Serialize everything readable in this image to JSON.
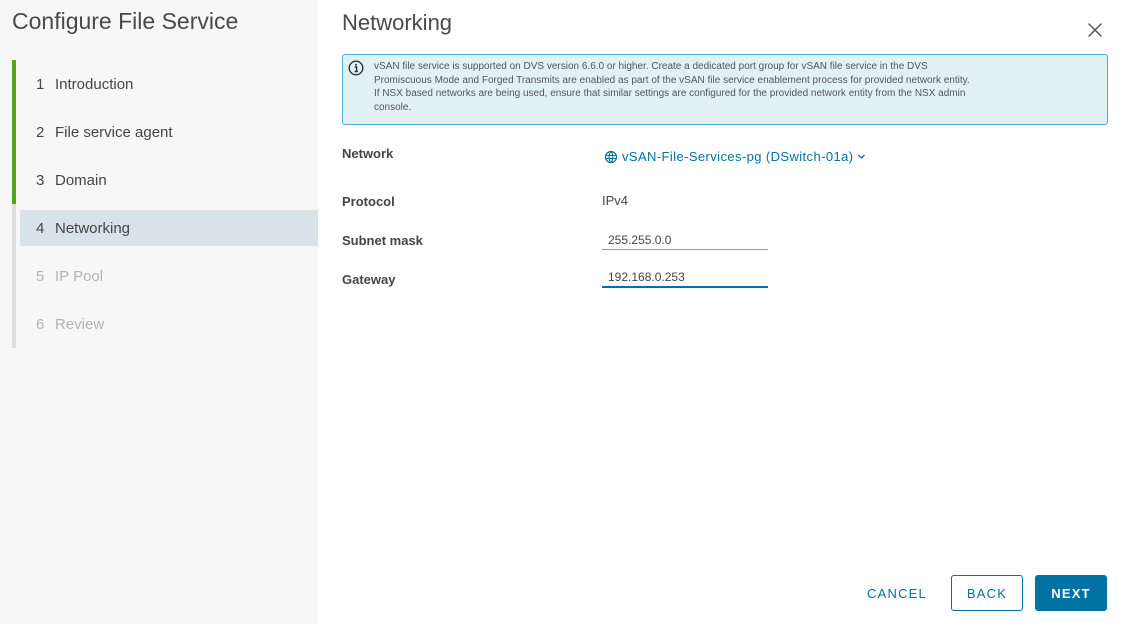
{
  "wizard": {
    "title": "Configure File Service",
    "steps": [
      {
        "num": "1",
        "label": "Introduction"
      },
      {
        "num": "2",
        "label": "File service agent"
      },
      {
        "num": "3",
        "label": "Domain"
      },
      {
        "num": "4",
        "label": "Networking"
      },
      {
        "num": "5",
        "label": "IP Pool"
      },
      {
        "num": "6",
        "label": "Review"
      }
    ]
  },
  "page": {
    "title": "Networking",
    "alert_lines": [
      "vSAN file service is supported on DVS version 6.6.0 or higher. Create a dedicated port group for vSAN file service in the DVS",
      "Promiscuous Mode and Forged Transmits are enabled as part of the vSAN file service enablement process for provided network entity.",
      "If NSX based networks are being used, ensure that similar settings are configured for the provided network entity from the NSX admin",
      "console."
    ]
  },
  "form": {
    "network_label": "Network",
    "network_value": "vSAN-File-Services-pg (DSwitch-01a)",
    "protocol_label": "Protocol",
    "protocol_value": "IPv4",
    "subnet_label": "Subnet mask",
    "subnet_value": "255.255.0.0",
    "gateway_label": "Gateway",
    "gateway_value": "192.168.0.253"
  },
  "buttons": {
    "cancel": "CANCEL",
    "back": "BACK",
    "next": "NEXT"
  },
  "colors": {
    "accent": "#0072a3",
    "completed_step": "#5aa220",
    "alert_bg": "#e1f1f6"
  }
}
